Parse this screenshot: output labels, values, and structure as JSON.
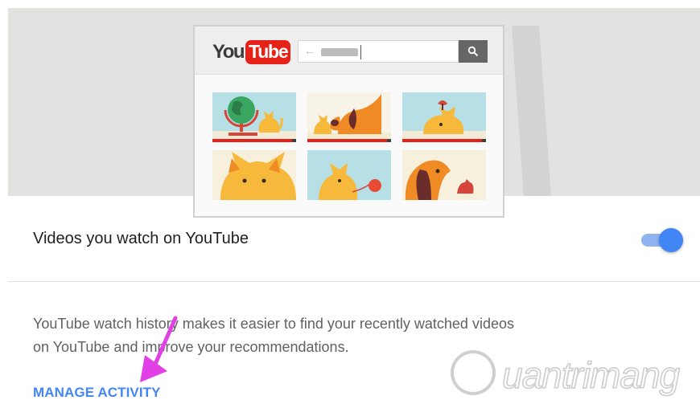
{
  "browser": {
    "logo": {
      "you": "You",
      "tube": "Tube"
    },
    "search": {
      "arrow": "←"
    }
  },
  "setting": {
    "title": "Videos you watch on YouTube",
    "toggle_on": true,
    "accent_color": "#4285f4",
    "description_line1": "YouTube watch history makes it easier to find your recently watched videos",
    "description_line2": "on YouTube and improve your recommendations.",
    "manage_link": "MANAGE ACTIVITY"
  },
  "watermark": {
    "text": "uantrimang"
  },
  "thumbnail_progress": [
    0.95,
    0.95,
    0.95
  ]
}
